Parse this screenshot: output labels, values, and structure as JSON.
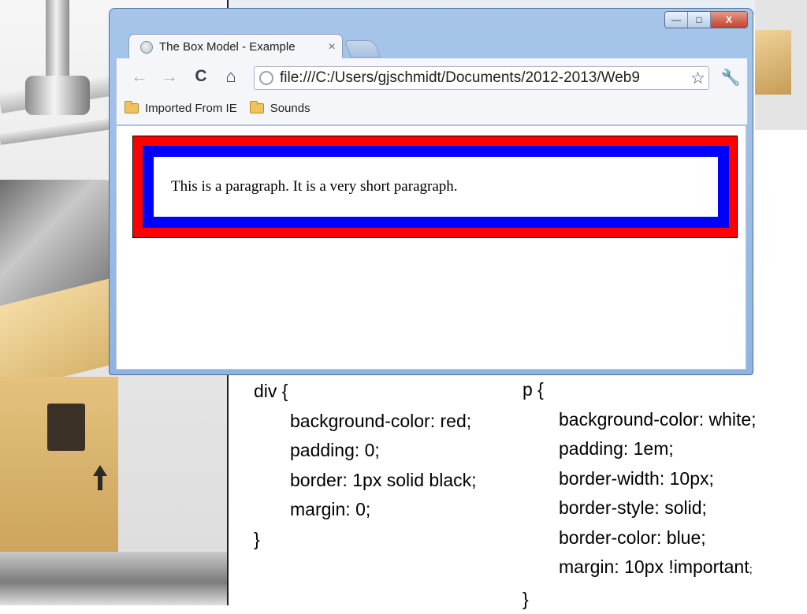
{
  "browser": {
    "tab_title": "The Box Model - Example",
    "tab_close": "×",
    "url": "file:///C:/Users/gjschmidt/Documents/2012-2013/Web9",
    "window_controls": {
      "minimize": "—",
      "maximize": "□",
      "close": "X"
    },
    "nav": {
      "back": "←",
      "forward": "→",
      "reload": "C",
      "home": "⌂",
      "bookmark": "☆",
      "wrench": "🔧"
    },
    "bookmarks": [
      "Imported From IE",
      "Sounds"
    ]
  },
  "example": {
    "paragraph_text": "This is a paragraph. It is a very short paragraph."
  },
  "css_div": {
    "selector_open": "div {",
    "lines": [
      "background-color: red;",
      "padding: 0;",
      "border: 1px solid black;",
      "margin: 0;"
    ],
    "close": "}"
  },
  "css_p": {
    "selector_open": "p {",
    "lines": [
      "background-color: white;",
      "padding: 1em;",
      "border-width: 10px;",
      "border-style: solid;",
      "border-color: blue;",
      "margin: 10px !important"
    ],
    "last_semicolon": ";",
    "close": "}"
  },
  "colors": {
    "div_background": "#ff0000",
    "p_border": "#0000ff",
    "p_background": "#ffffff",
    "window_frame": "#8eb4e3"
  }
}
